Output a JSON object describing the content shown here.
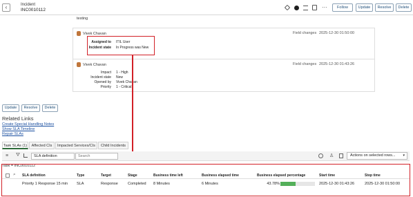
{
  "header": {
    "title": "Incident",
    "number": "INC0010112",
    "buttons": [
      "Follow",
      "Update",
      "Resolve",
      "Delete"
    ]
  },
  "activity": {
    "top_text": "testing",
    "entry1": {
      "author": "Vivek Chavan",
      "type": "Field changes",
      "time": "2025-12-30 01:50:00",
      "fields": [
        {
          "label": "Assigned to",
          "value": "ITIL User"
        },
        {
          "label": "Incident state",
          "value": "In Progress  was  New"
        }
      ]
    },
    "entry2": {
      "author": "Vivek Chavan",
      "type": "Field changes",
      "time": "2025-12-30 01:43:26",
      "fields": [
        {
          "label": "Impact",
          "value": "1 - High"
        },
        {
          "label": "Incident state",
          "value": "New"
        },
        {
          "label": "Opened by",
          "value": "Vivek Chavan"
        },
        {
          "label": "Priority",
          "value": "1 - Critical"
        }
      ]
    }
  },
  "form_buttons": [
    "Update",
    "Resolve",
    "Delete"
  ],
  "related_links": {
    "title": "Related Links",
    "links": [
      "Create Special Handling Notes",
      "Show SLA Timeline",
      "Repair SLAs"
    ]
  },
  "tabs": [
    "Task SLAs (1)",
    "Affected CIs",
    "Impacted Services/CIs",
    "Child Incidents"
  ],
  "list_toolbar": {
    "filter_field": "SLA definition",
    "search_placeholder": "Search",
    "actions": "Actions on selected rows..."
  },
  "breadcrumb": "Task = INC0010112",
  "table": {
    "columns": [
      "SLA definition",
      "Type",
      "Target",
      "Stage",
      "Business time left",
      "Business elapsed time",
      "Business elapsed percentage",
      "Start time",
      "Stop time"
    ],
    "rows": [
      {
        "sla_definition": "Priority 1 Response 15 min",
        "type": "SLA",
        "target": "Response",
        "stage": "Completed",
        "business_time_left": "8 Minutes",
        "business_elapsed_time": "6 Minutes",
        "business_elapsed_percentage": "43.78%",
        "percentage_value": 43.78,
        "start_time": "2025-12-30 01:43:26",
        "stop_time": "2025-12-30 01:50:00"
      }
    ]
  },
  "colors": {
    "highlight": "#d21f26",
    "progress": "#54b05a",
    "link": "#1a4fa0"
  }
}
